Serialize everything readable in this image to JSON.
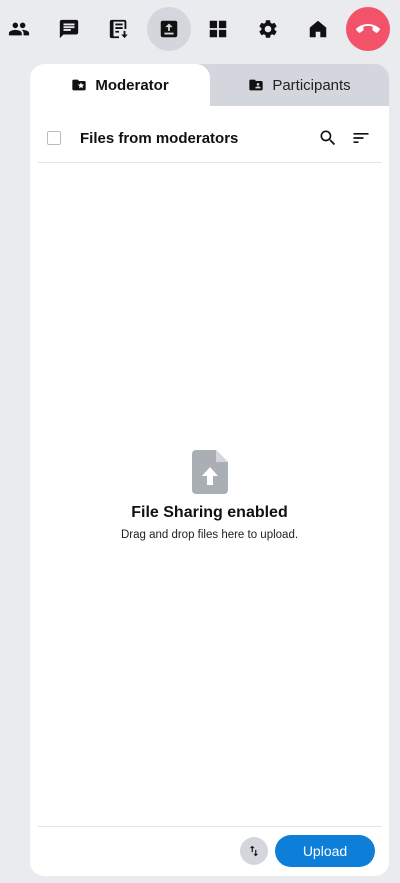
{
  "toolbar": {
    "items": [
      {
        "name": "participants-icon"
      },
      {
        "name": "chat-icon"
      },
      {
        "name": "notes-icon"
      },
      {
        "name": "file-sharing-icon",
        "active": true
      },
      {
        "name": "apps-grid-icon"
      },
      {
        "name": "settings-gear-icon"
      },
      {
        "name": "home-icon"
      },
      {
        "name": "hang-up-icon"
      }
    ],
    "colors": {
      "active_bg": "#d3d6dc",
      "hangup": "#f2536b"
    }
  },
  "tabs": {
    "moderator_label": "Moderator",
    "participants_label": "Participants"
  },
  "files": {
    "header_title": "Files from moderators"
  },
  "empty_state": {
    "title": "File Sharing enabled",
    "subtitle": "Drag and drop files here to upload."
  },
  "footer": {
    "upload_label": "Upload"
  },
  "colors": {
    "accent": "#0e7fd8",
    "background": "#e9ebef"
  }
}
